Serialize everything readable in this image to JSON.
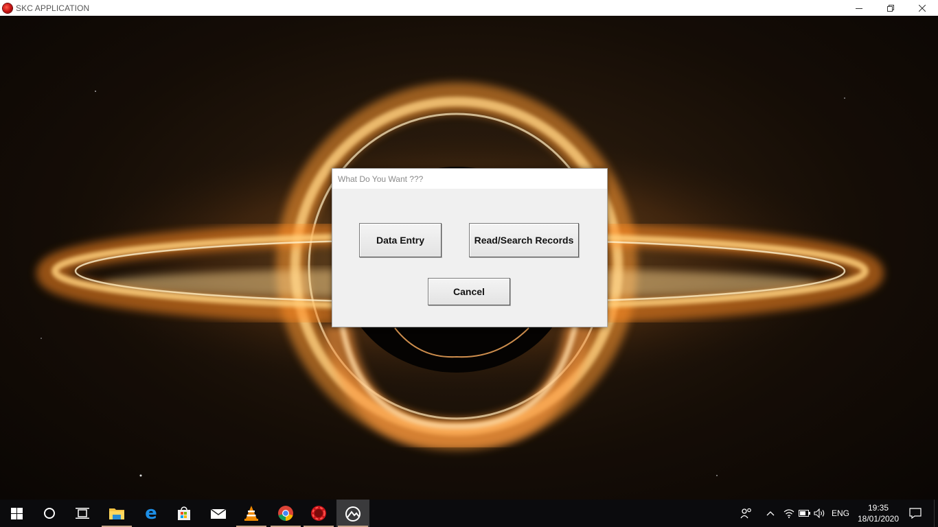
{
  "window": {
    "title": "SKC APPLICATION",
    "controls": [
      "minimize-icon",
      "restore-icon",
      "close-icon"
    ]
  },
  "dialog": {
    "title": "What Do You Want ???",
    "buttons": {
      "data_entry": "Data Entry",
      "read_search": "Read/Search Records",
      "cancel": "Cancel"
    }
  },
  "taskbar": {
    "pinned": [
      {
        "name": "start-icon",
        "running": false
      },
      {
        "name": "search-icon",
        "running": false
      },
      {
        "name": "task-view-icon",
        "running": false
      },
      {
        "name": "file-explorer-icon",
        "running": true
      },
      {
        "name": "edge-icon",
        "running": false
      },
      {
        "name": "store-icon",
        "running": false
      },
      {
        "name": "mail-icon",
        "running": false
      },
      {
        "name": "vlc-icon",
        "running": true
      },
      {
        "name": "chrome-icon",
        "running": true
      },
      {
        "name": "red-app-icon",
        "running": true
      },
      {
        "name": "skc-app-icon",
        "running": true,
        "active": true
      }
    ],
    "tray": {
      "language": "ENG",
      "time": "19:35",
      "date": "18/01/2020"
    }
  },
  "colors": {
    "dialog_bg": "#f0f0f0",
    "taskbar_bg": "#0b0b0d",
    "accretion_glow": "#ffb040"
  }
}
